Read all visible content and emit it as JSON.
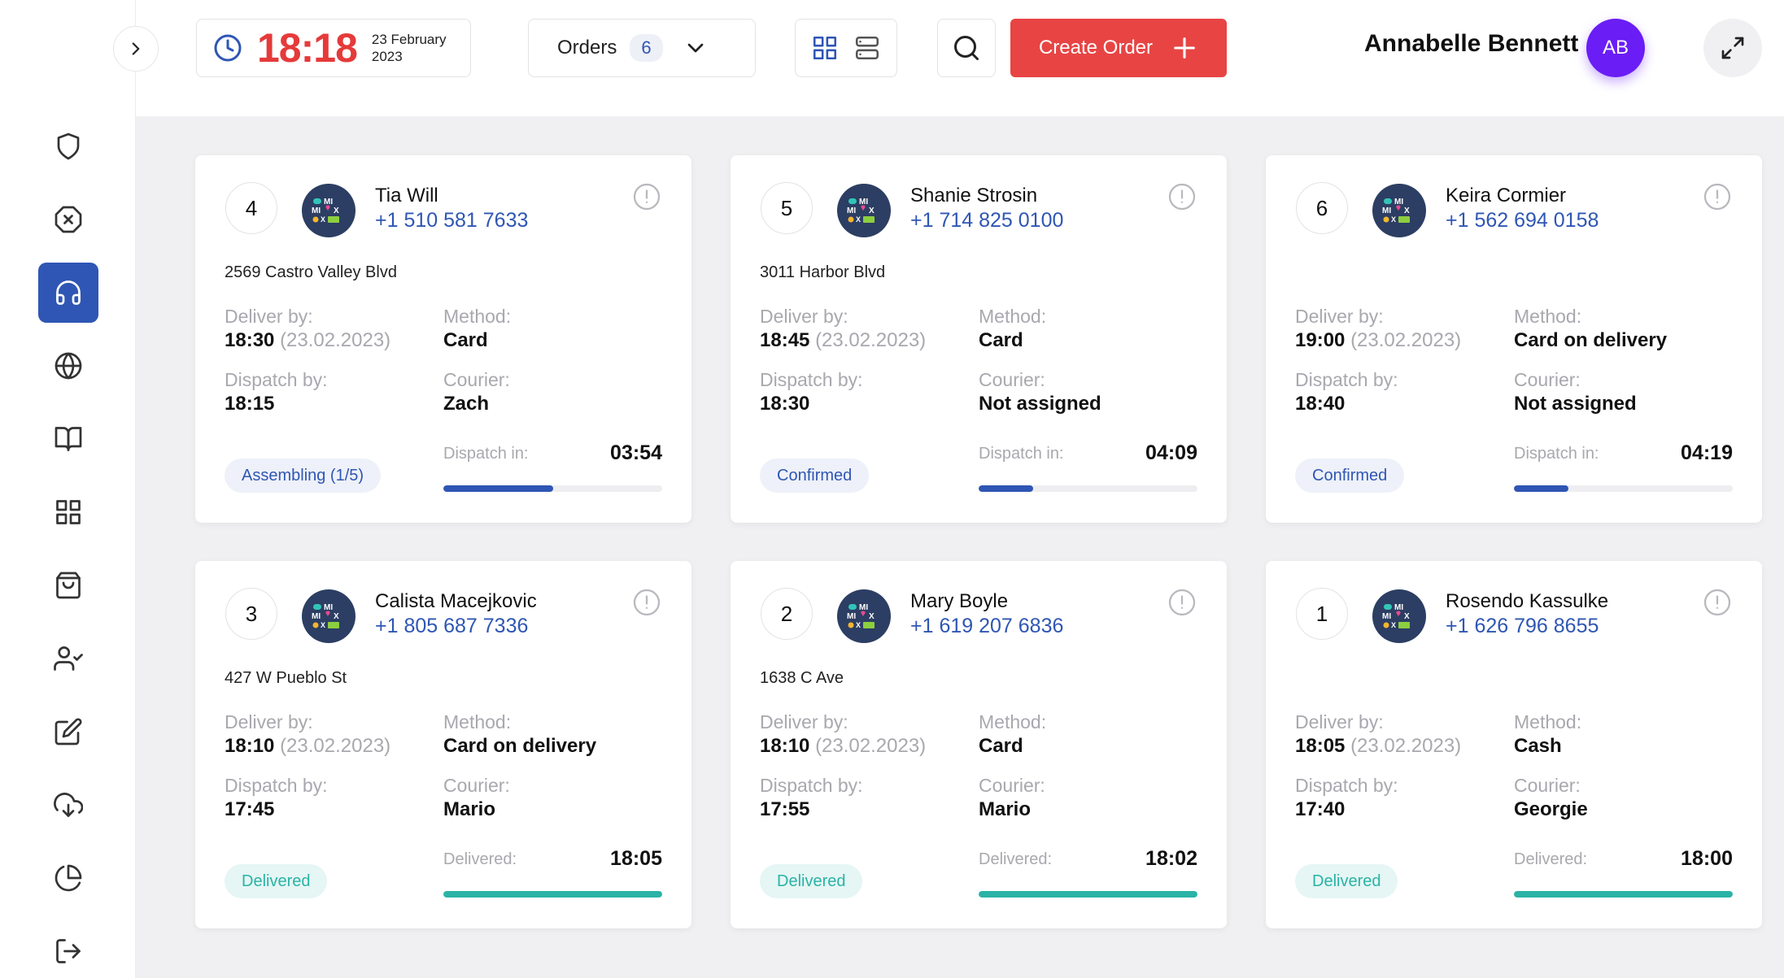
{
  "header": {
    "clock_time": "18:18",
    "clock_date_line1": "23 February",
    "clock_date_line2": "2023",
    "orders_label": "Orders",
    "orders_count": "6",
    "create_label": "Create Order",
    "user_name": "Annabelle Bennett",
    "avatar_initials": "AB"
  },
  "colors": {
    "primary": "#2f56b4",
    "danger": "#e84444",
    "clock": "#e53a3a",
    "avatar": "#6a1df5",
    "teal": "#2ab3a6"
  },
  "sidebar": {
    "items": [
      {
        "icon": "shield-icon",
        "active": false
      },
      {
        "icon": "cancel-circle-icon",
        "active": false
      },
      {
        "icon": "headphones-icon",
        "active": true
      },
      {
        "icon": "globe-icon",
        "active": false
      },
      {
        "icon": "book-icon",
        "active": false
      },
      {
        "icon": "grid-icon",
        "active": false
      },
      {
        "icon": "shopping-bag-icon",
        "active": false
      },
      {
        "icon": "user-check-icon",
        "active": false
      },
      {
        "icon": "edit-icon",
        "active": false
      },
      {
        "icon": "download-cloud-icon",
        "active": false
      },
      {
        "icon": "pie-chart-icon",
        "active": false
      },
      {
        "icon": "logout-icon",
        "active": false
      }
    ]
  },
  "labels": {
    "deliver_by": "Deliver by:",
    "method": "Method:",
    "dispatch_by": "Dispatch by:",
    "courier": "Courier:"
  },
  "orders": [
    {
      "number": "4",
      "name": "Tia Will",
      "phone": "+1 510 581 7633",
      "address": "2569 Castro Valley Blvd",
      "deliver_time": "18:30",
      "deliver_date": "(23.02.2023)",
      "method": "Card",
      "dispatch_time": "18:15",
      "courier": "Zach",
      "status": "Assembling (1/5)",
      "status_style": "blue",
      "timer_label": "Dispatch in:",
      "timer_value": "03:54",
      "progress": 0.5,
      "bar_style": "blue"
    },
    {
      "number": "5",
      "name": "Shanie Strosin",
      "phone": "+1 714 825 0100",
      "address": "3011 Harbor Blvd",
      "deliver_time": "18:45",
      "deliver_date": "(23.02.2023)",
      "method": "Card",
      "dispatch_time": "18:30",
      "courier": "Not assigned",
      "status": "Confirmed",
      "status_style": "blue",
      "timer_label": "Dispatch in:",
      "timer_value": "04:09",
      "progress": 0.25,
      "bar_style": "blue"
    },
    {
      "number": "6",
      "name": "Keira Cormier",
      "phone": "+1 562 694 0158",
      "address": "",
      "deliver_time": "19:00",
      "deliver_date": "(23.02.2023)",
      "method": "Card on delivery",
      "dispatch_time": "18:40",
      "courier": "Not assigned",
      "status": "Confirmed",
      "status_style": "blue",
      "timer_label": "Dispatch in:",
      "timer_value": "04:19",
      "progress": 0.25,
      "bar_style": "blue"
    },
    {
      "number": "3",
      "name": "Calista Macejkovic",
      "phone": "+1 805 687 7336",
      "address": "427 W Pueblo St",
      "deliver_time": "18:10",
      "deliver_date": "(23.02.2023)",
      "method": "Card on delivery",
      "dispatch_time": "17:45",
      "courier": "Mario",
      "status": "Delivered",
      "status_style": "green",
      "timer_label": "Delivered:",
      "timer_value": "18:05",
      "progress": 1.0,
      "bar_style": "green"
    },
    {
      "number": "2",
      "name": "Mary Boyle",
      "phone": "+1 619 207 6836",
      "address": "1638 C Ave",
      "deliver_time": "18:10",
      "deliver_date": "(23.02.2023)",
      "method": "Card",
      "dispatch_time": "17:55",
      "courier": "Mario",
      "status": "Delivered",
      "status_style": "green",
      "timer_label": "Delivered:",
      "timer_value": "18:02",
      "progress": 1.0,
      "bar_style": "green"
    },
    {
      "number": "1",
      "name": "Rosendo Kassulke",
      "phone": "+1 626 796 8655",
      "address": "",
      "deliver_time": "18:05",
      "deliver_date": "(23.02.2023)",
      "method": "Cash",
      "dispatch_time": "17:40",
      "courier": "Georgie",
      "status": "Delivered",
      "status_style": "green",
      "timer_label": "Delivered:",
      "timer_value": "18:00",
      "progress": 1.0,
      "bar_style": "green"
    }
  ]
}
